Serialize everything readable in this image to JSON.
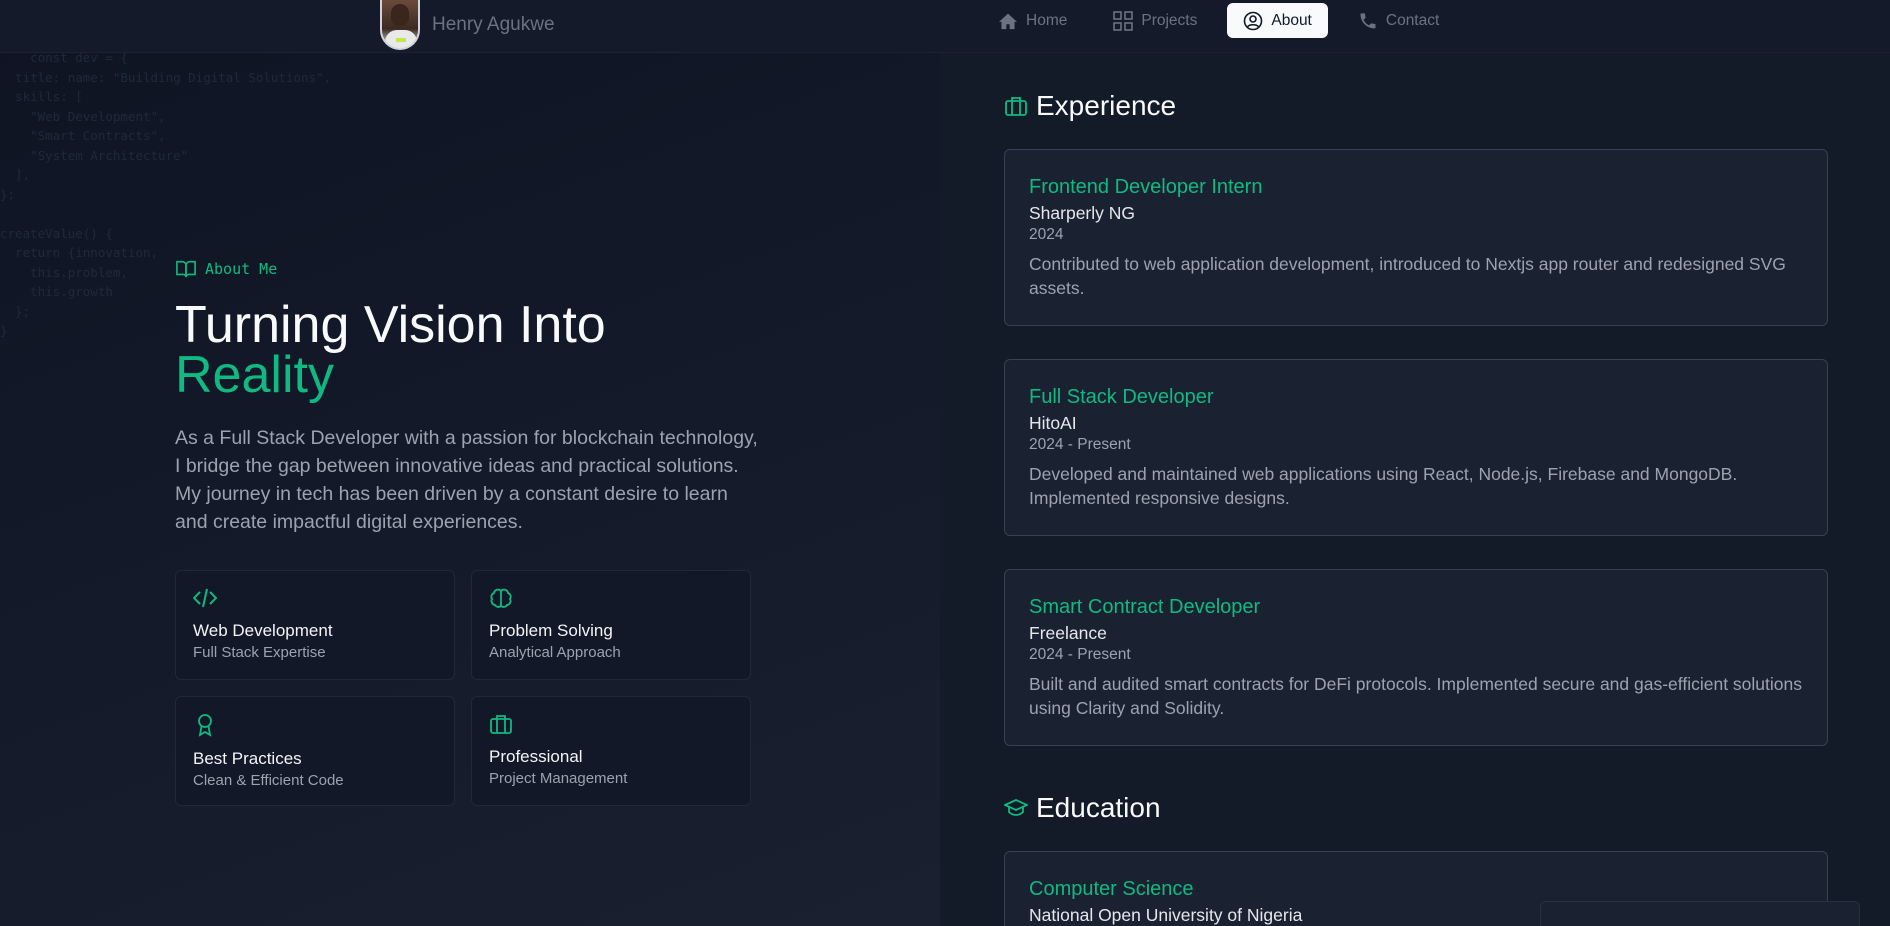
{
  "code_background": "    const dev = {\n  title: name: \"Building Digital Solutions\",\n  skills: [\n    \"Web Development\",\n    \"Smart Contracts\",\n    \"System Architecture\"\n  ],\n};\n\ncreateValue() {\n  return {innovation,\n    this.problem,\n    this.growth\n  };\n}",
  "nav": {
    "brand_name": "Henry Agukwe",
    "items": [
      {
        "label": "Home",
        "icon": "home-icon"
      },
      {
        "label": "Projects",
        "icon": "grid-icon"
      },
      {
        "label": "About",
        "icon": "user-circle-icon",
        "active": true
      },
      {
        "label": "Contact",
        "icon": "phone-icon"
      }
    ]
  },
  "about": {
    "label": "About Me",
    "title_line1": "Turning Vision Into",
    "title_line2": "Reality",
    "description": "As a Full Stack Developer with a passion for blockchain technology, I bridge the gap between innovative ideas and practical solutions. My journey in tech has been driven by a constant desire to learn and create impactful digital experiences.",
    "skills": [
      {
        "title": "Web Development",
        "subtitle": "Full Stack Expertise",
        "icon": "code-icon"
      },
      {
        "title": "Problem Solving",
        "subtitle": "Analytical Approach",
        "icon": "brain-icon"
      },
      {
        "title": "Best Practices",
        "subtitle": "Clean & Efficient Code",
        "icon": "award-icon"
      },
      {
        "title": "Professional",
        "subtitle": "Project Management",
        "icon": "briefcase-icon"
      }
    ]
  },
  "experience": {
    "heading": "Experience",
    "items": [
      {
        "role": "Frontend Developer Intern",
        "company": "Sharperly NG",
        "period": "2024",
        "description": "Contributed to web application development, introduced to Nextjs app router and redesigned SVG assets."
      },
      {
        "role": "Full Stack Developer",
        "company": "HitoAI",
        "period": "2024 - Present",
        "description": "Developed and maintained web applications using React, Node.js, Firebase and MongoDB. Implemented responsive designs."
      },
      {
        "role": "Smart Contract Developer",
        "company": "Freelance",
        "period": "2024 - Present",
        "description": "Built and audited smart contracts for DeFi protocols. Implemented secure and gas-efficient solutions using Clarity and Solidity."
      }
    ]
  },
  "education": {
    "heading": "Education",
    "items": [
      {
        "field": "Computer Science",
        "school": "National Open University of Nigeria"
      }
    ]
  },
  "colors": {
    "accent": "#10b981",
    "background": "#111827",
    "card": "#1a2232"
  }
}
